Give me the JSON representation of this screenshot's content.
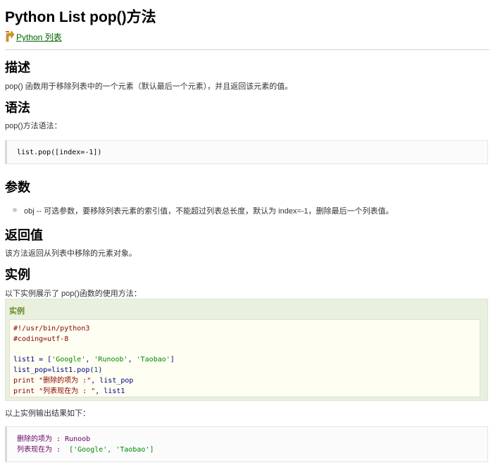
{
  "title": "Python List pop()方法",
  "back_link": "Python 列表",
  "sections": {
    "desc": {
      "heading": "描述",
      "text": "pop() 函数用于移除列表中的一个元素（默认最后一个元素），并且返回该元素的值。"
    },
    "syntax": {
      "heading": "语法",
      "text": "pop()方法语法：",
      "code": "list.pop([index=-1])"
    },
    "params": {
      "heading": "参数",
      "item": "obj -- 可选参数，要移除列表元素的索引值，不能超过列表总长度，默认为 index=-1，删除最后一个列表值。"
    },
    "return": {
      "heading": "返回值",
      "text": "该方法返回从列表中移除的元素对象。"
    },
    "example": {
      "heading": "实例",
      "intro": "以下实例展示了 pop()函数的使用方法：",
      "box_title": "实例",
      "code": {
        "line1": "#!/usr/bin/python3",
        "line2": "#coding=utf-8",
        "line4_a": "list1 = [",
        "line4_s1": "'Google'",
        "line4_c1": ", ",
        "line4_s2": "'Runoob'",
        "line4_c2": ", ",
        "line4_s3": "'Taobao'",
        "line4_e": "]",
        "line5_a": "list_pop=list1.pop(",
        "line5_n": "1",
        "line5_e": ")",
        "line6_kw": "print",
        "line6_s": " \"删除的项为 :\"",
        "line6_e": ", list_pop",
        "line7_kw": "print",
        "line7_s": " \"列表现在为 : \"",
        "line7_e": ", list1"
      },
      "output_intro": "以上实例输出结果如下：",
      "output": {
        "l1_label": "删除的项为 :",
        "l1_val": " Runoob",
        "l2_label": "列表现在为 :",
        "l2_val": "  ['Google', 'Taobao']"
      }
    }
  },
  "colors": {
    "link": "#006600",
    "example_bg": "#e9f0de",
    "example_title": "#6a8c2d",
    "code_string": "#008800",
    "code_comment": "#880000"
  },
  "icons": {
    "back": "up-arrow-icon"
  }
}
